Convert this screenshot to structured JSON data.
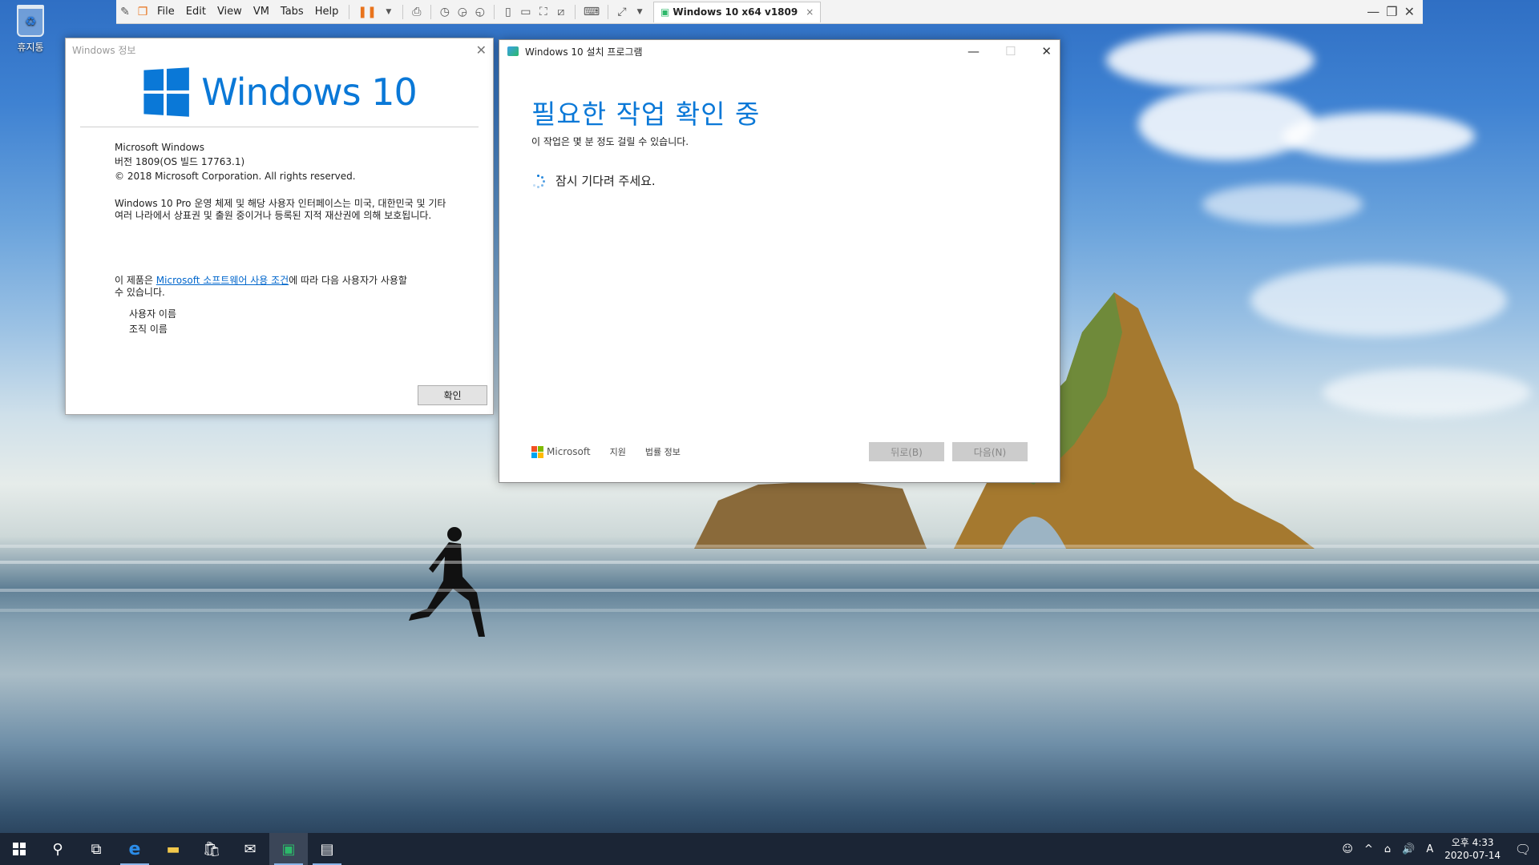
{
  "desktop": {
    "recycle_bin_label": "휴지통"
  },
  "vmware": {
    "menus": [
      "File",
      "Edit",
      "View",
      "VM",
      "Tabs",
      "Help"
    ],
    "tab_title": "Windows 10 x64 v1809",
    "tab_close": "×"
  },
  "about": {
    "title": "Windows 정보",
    "close": "✕",
    "logo_text": "Windows 10",
    "product": "Microsoft Windows",
    "version": "버전 1809(OS 빌드 17763.1)",
    "copyright": "© 2018 Microsoft Corporation. All rights reserved.",
    "legal": "Windows 10 Pro 운영 체제 및 해당 사용자 인터페이스는 미국, 대한민국 및 기타 여러 나라에서 상표권 및 출원 중이거나 등록된 지적 재산권에 의해 보호됩니다.",
    "license_prefix": "이 제품은 ",
    "license_link": "Microsoft 소프트웨어 사용 조건",
    "license_suffix": "에 따라 다음 사용자가 사용할 수 있습니다.",
    "user_name": "사용자 이름",
    "org_name": "조직 이름",
    "ok": "확인"
  },
  "setup": {
    "title": "Windows 10 설치 프로그램",
    "heading": "필요한 작업 확인 중",
    "subtext": "이 작업은 몇 분 정도 걸릴 수 있습니다.",
    "wait": "잠시 기다려 주세요.",
    "brand": "Microsoft",
    "support": "지원",
    "legal": "법률 정보",
    "back": "뒤로(B)",
    "next": "다음(N)",
    "colors": {
      "accent": "#0a78d7"
    }
  },
  "taskbar": {
    "time": "오후 4:33",
    "date": "2020-07-14",
    "ime": "A"
  }
}
